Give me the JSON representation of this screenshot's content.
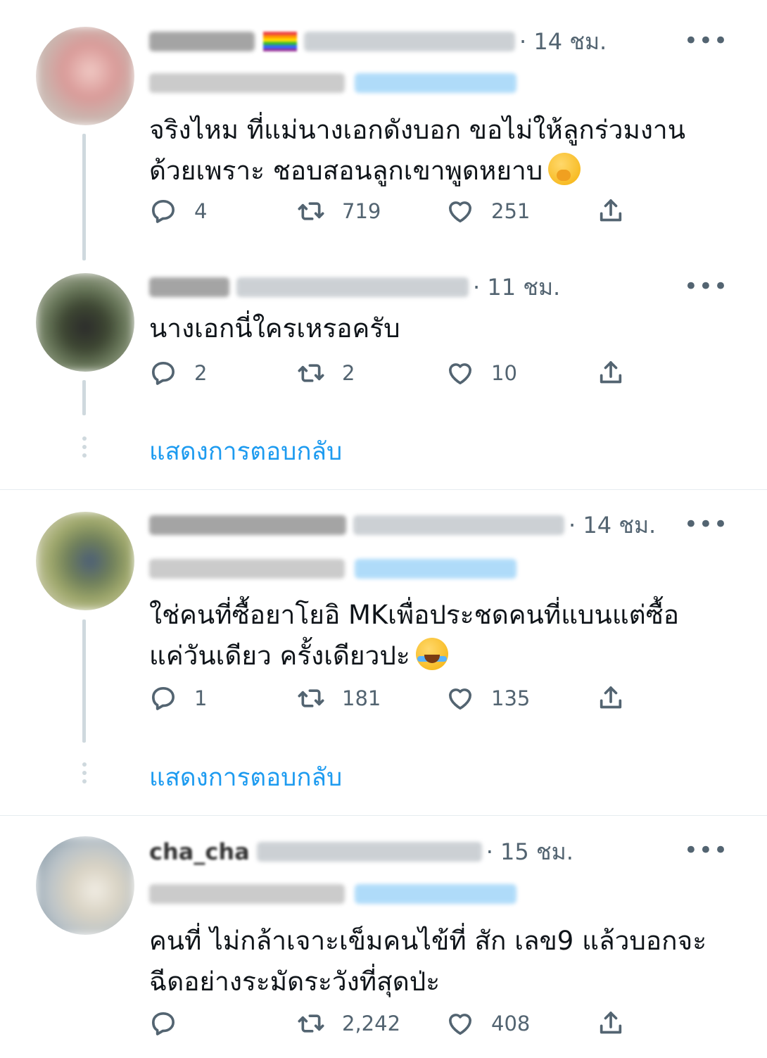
{
  "colors": {
    "accent": "#1d9bf0",
    "muted": "#536471",
    "text": "#0f1419",
    "line": "#cfd9de"
  },
  "show_replies_label": "แสดงการตอบกลับ",
  "tweets": [
    {
      "time": "· 14 ชม.",
      "more": "•••",
      "text_line1": "จริงไหม ที่แม่นางเอกดังบอก ขอไม่ให้ลูกร่วมงาน",
      "text_line2": "ด้วยเพราะ ชอบสอนลูกเขาพูดหยาบ",
      "emoji": "face-with-hand-over-mouth",
      "replies": "4",
      "retweets": "719",
      "likes": "251"
    },
    {
      "time": "· 11 ชม.",
      "more": "•••",
      "text_line1": "นางเอกนี่ใครเหรอครับ",
      "replies": "2",
      "retweets": "2",
      "likes": "10"
    },
    {
      "time": "· 14 ชม.",
      "more": "•••",
      "text_line1": "ใช่คนที่ซื้อยาโยอิ MKเพื่อประชดคนที่แบนแต่ซื้อ",
      "text_line2": "แค่วันเดียว ครั้งเดียวปะ",
      "emoji": "face-with-tears-of-joy",
      "replies": "1",
      "retweets": "181",
      "likes": "135"
    },
    {
      "name": "cha_cha",
      "time": "· 15 ชม.",
      "more": "•••",
      "text_line1": "คนที่ ไม่กล้าเจาะเข็มคนไข้ที่ สัก เลข9 แล้วบอกจะ",
      "text_line2": "ฉีดอย่างระมัดระวังที่สุดป่ะ",
      "replies": "",
      "retweets": "2,242",
      "likes": "408"
    }
  ]
}
